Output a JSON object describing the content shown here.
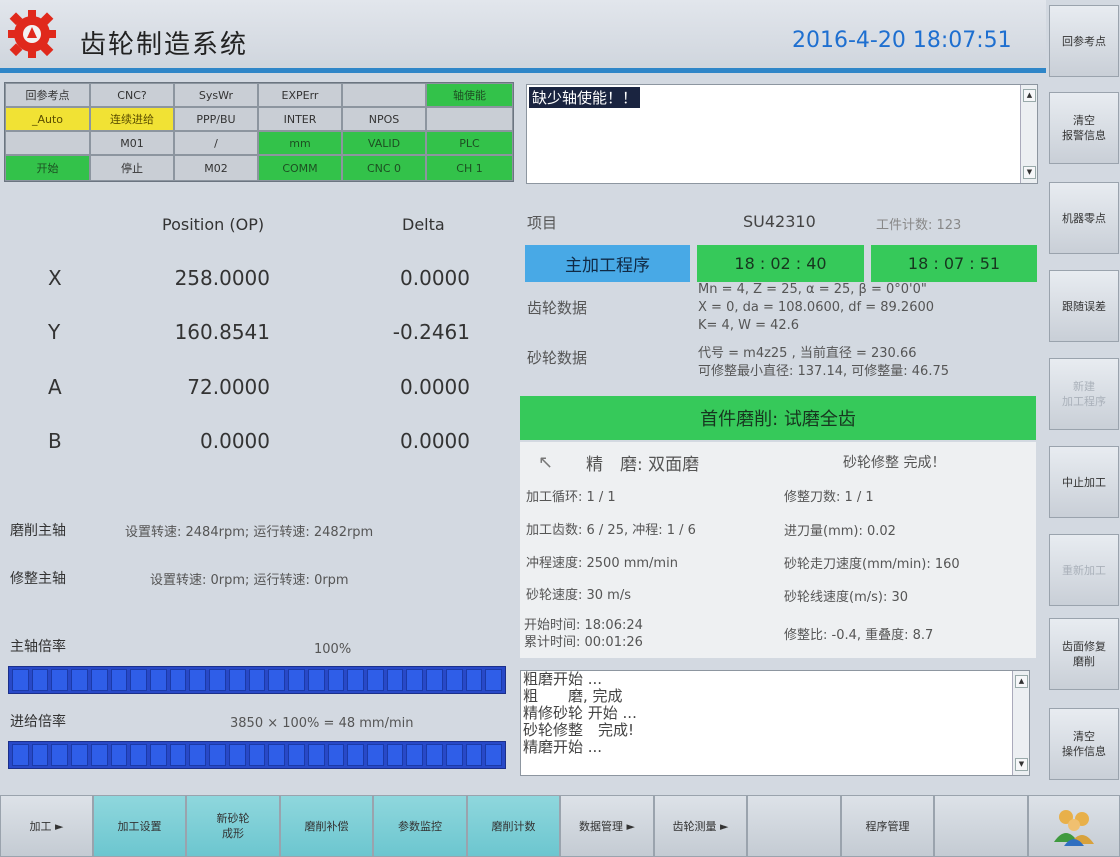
{
  "header": {
    "title": "齿轮制造系统",
    "datetime": "2016-4-20 18:07:51"
  },
  "side_buttons": [
    {
      "label": "回参考点",
      "enabled": true
    },
    {
      "label": "清空\n报警信息",
      "enabled": true
    },
    {
      "label": "机器零点",
      "enabled": true
    },
    {
      "label": "跟随误差",
      "enabled": true
    },
    {
      "label": "新建\n加工程序",
      "enabled": false
    },
    {
      "label": "中止加工",
      "enabled": true
    },
    {
      "label": "重新加工",
      "enabled": false
    },
    {
      "label": "齿面修复\n磨削",
      "enabled": true
    },
    {
      "label": "清空\n操作信息",
      "enabled": true
    }
  ],
  "status_grid": {
    "r1": [
      "回参考点",
      "CNC?",
      "SysWr",
      "EXPErr",
      "",
      "轴使能"
    ],
    "r2": [
      "_Auto",
      "连续进给",
      "PPP/BU",
      "INTER",
      "NPOS",
      ""
    ],
    "r3": [
      "",
      "M01",
      "/",
      "mm",
      "VALID",
      "PLC"
    ],
    "r4": [
      "开始",
      "停止",
      "M02",
      "COMM",
      "CNC 0",
      "CH 1"
    ]
  },
  "alarm": {
    "message": "缺少轴使能！！"
  },
  "positions": {
    "col_position": "Position (OP)",
    "col_delta": "Delta",
    "rows": [
      {
        "axis": "X",
        "position": "258.0000",
        "delta": "0.0000"
      },
      {
        "axis": "Y",
        "position": "160.8541",
        "delta": "-0.2461"
      },
      {
        "axis": "A",
        "position": "72.0000",
        "delta": "0.0000"
      },
      {
        "axis": "B",
        "position": "0.0000",
        "delta": "0.0000"
      }
    ]
  },
  "spindles": {
    "grind_label": "磨削主轴",
    "grind_value": "设置转速: 2484rpm; 运行转速: 2482rpm",
    "dress_label": "修整主轴",
    "dress_value": "设置转速: 0rpm; 运行转速: 0rpm"
  },
  "override": {
    "spindle_label": "主轴倍率",
    "spindle_value": "100%",
    "spindle_fraction": 1.0,
    "feed_label": "进给倍率",
    "feed_value": "3850 × 100% = 48 mm/min",
    "feed_fraction": 1.0
  },
  "project": {
    "label": "项目",
    "name": "SU42310",
    "count": "工件计数: 123",
    "program_button": "主加工程序",
    "time_start": "18 : 02 : 40",
    "time_now": "18 : 07 : 51",
    "gear_label": "齿轮数据",
    "gear_line1": "Mn = 4, Z = 25, α = 25, β = 0°0'0\"",
    "gear_line2": "X = 0, da = 108.0600, df = 89.2600",
    "gear_line3": "K= 4, W = 42.6",
    "wheel_label": "砂轮数据",
    "wheel_line1": "代号 = m4z25 , 当前直径 = 230.66",
    "wheel_line2": "可修整最小直径: 137.14, 可修整量: 46.75"
  },
  "banner": "首件磨削: 试磨全齿",
  "grind": {
    "mode": "精　磨: 双面磨",
    "dress_status": "砂轮修整 完成！",
    "cycle": "加工循环: 1 / 1",
    "teeth": "加工齿数: 6 / 25, 冲程: 1 / 6",
    "stroke_speed": "冲程速度: 2500 mm/min",
    "wheel_speed": "砂轮速度: 30 m/s",
    "start_time": "开始时间: 18:06:24",
    "total_time": "累计时间: 00:01:26",
    "dress_count": "修整刀数: 1 / 1",
    "feed_amount": "进刀量(mm): 0.02",
    "wheel_traverse": "砂轮走刀速度(mm/min): 160",
    "wheel_linear": "砂轮线速度(m/s): 30",
    "dress_ratio": "修整比: -0.4, 重叠度: 8.7"
  },
  "log": [
    "粗磨开始 ...",
    "粗　　磨, 完成",
    "精修砂轮 开始 ...",
    "砂轮修整　完成!",
    "精磨开始 ..."
  ],
  "bottom_bar": [
    {
      "label": "加工 ►",
      "active": false
    },
    {
      "label": "加工设置",
      "active": true
    },
    {
      "label": "新砂轮\n成形",
      "active": true
    },
    {
      "label": "磨削补偿",
      "active": true
    },
    {
      "label": "参数监控",
      "active": true
    },
    {
      "label": "磨削计数",
      "active": true
    },
    {
      "label": "数据管理 ►",
      "active": false
    },
    {
      "label": "齿轮测量 ►",
      "active": false
    },
    {
      "label": "",
      "active": false
    },
    {
      "label": "程序管理",
      "active": false
    },
    {
      "label": "",
      "active": false
    }
  ],
  "colors": {
    "accent_blue": "#2f86c8",
    "status_green": "#33c24a",
    "status_yellow": "#f1e234",
    "progress_blue": "#2f5ee8",
    "datetime_blue": "#1e6fd0"
  }
}
